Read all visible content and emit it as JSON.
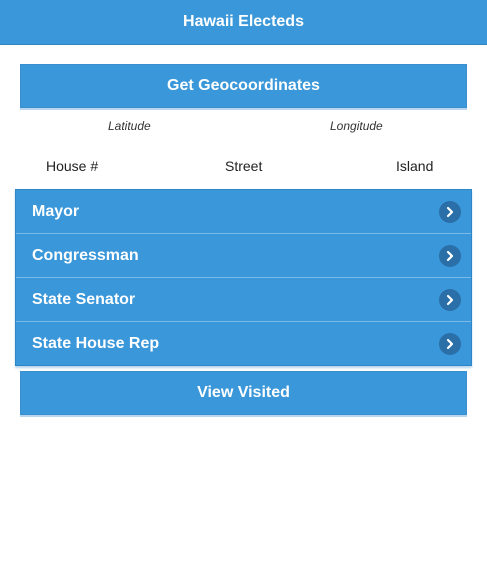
{
  "header": {
    "title": "Hawaii Electeds"
  },
  "actions": {
    "geocoordinates_label": "Get Geocoordinates",
    "view_visited_label": "View Visited"
  },
  "coordinates": {
    "latitude_label": "Latitude",
    "longitude_label": "Longitude"
  },
  "address": {
    "house_label": "House #",
    "street_label": "Street",
    "island_label": "Island"
  },
  "electeds": {
    "items": [
      {
        "label": "Mayor",
        "icon": "chevron-right-icon"
      },
      {
        "label": "Congressman",
        "icon": "chevron-right-icon"
      },
      {
        "label": "State Senator",
        "icon": "chevron-right-icon"
      },
      {
        "label": "State House Rep",
        "icon": "chevron-right-icon"
      }
    ]
  },
  "colors": {
    "primary": "#3a97d9",
    "chevron_bg": "#2a6fa8",
    "divider": "#7cbbe8",
    "text_on_primary": "#ffffff"
  }
}
